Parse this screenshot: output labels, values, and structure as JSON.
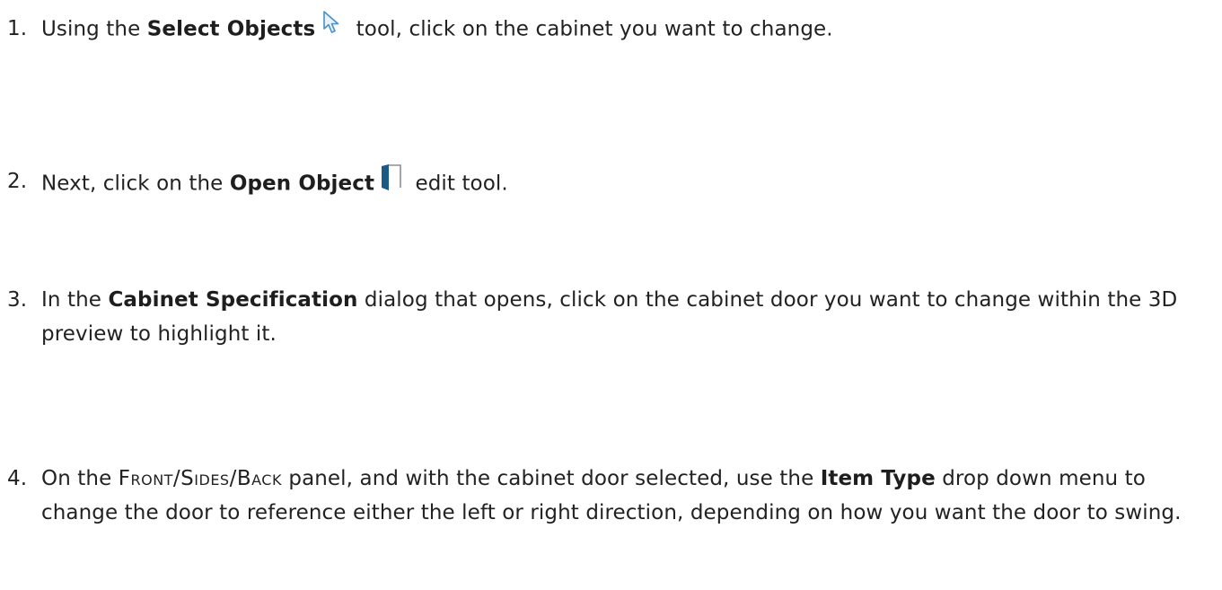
{
  "steps": [
    {
      "number": "1.",
      "pre": "Using the ",
      "bold": "Select Objects",
      "icon": "select-objects-arrow-icon",
      "post": " tool, click on the cabinet you want to change."
    },
    {
      "number": "2.",
      "pre": "Next, click on the ",
      "bold": "Open Object",
      "icon": "open-object-door-icon",
      "post": " edit tool."
    },
    {
      "number": "3.",
      "pre": "In the ",
      "bold": "Cabinet Specification",
      "post": " dialog that opens, click on the cabinet door you want to change within the 3D preview to highlight it."
    },
    {
      "number": "4.",
      "pre": "On the ",
      "panel_name": "Front/Sides/Back",
      "mid": " panel, and with the cabinet door selected, use the ",
      "bold": "Item Type",
      "post": " drop down menu to change the door to reference either the left or right direction, depending on how you want the door to swing."
    }
  ],
  "colors": {
    "text": "#222222",
    "icon_outline": "#4a90c8",
    "icon_fill": "#e8f2fb",
    "door_dark": "#1c5a86",
    "door_frame": "#8a8f96"
  }
}
